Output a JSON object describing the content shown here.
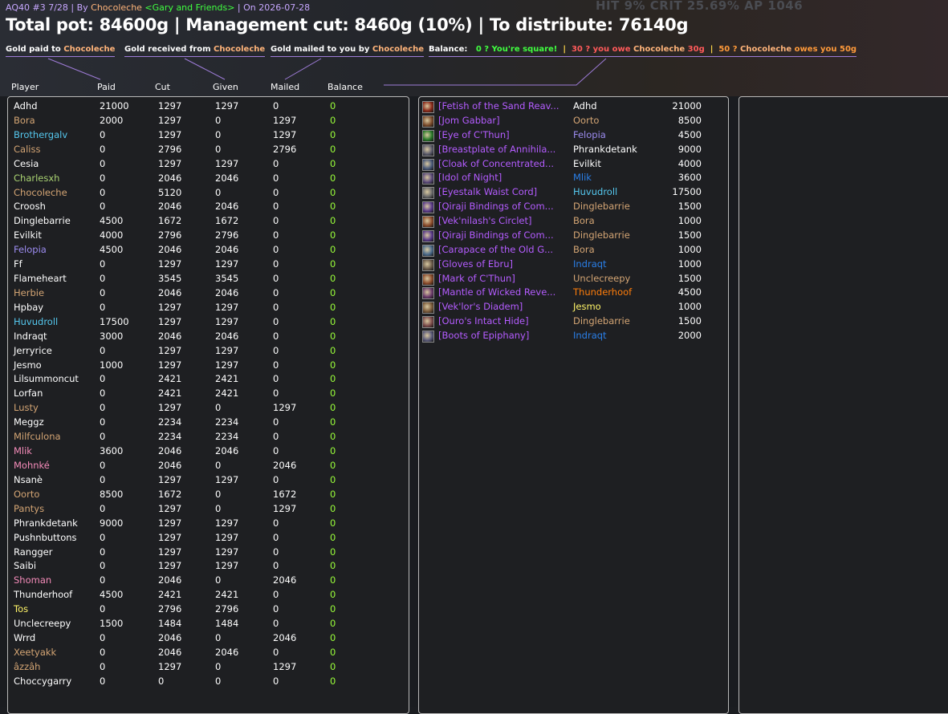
{
  "hud_text": "HIT 9%  CRIT 25.69%  AP 1046",
  "header": {
    "prefix": "AQ40 #3 7/28 | By ",
    "author": "Chocoleche",
    "guild": " <Gary and Friends>",
    "suffix": " | On 2026-07-28",
    "title": "Total pot: 84600g | Management cut: 8460g (10%) | To distribute: 76140g"
  },
  "legends": {
    "paid_text": "Gold paid to ",
    "paid_name": "Chocoleche",
    "received_text": "Gold received from ",
    "received_name": "Chocoleche",
    "mailed_text": "Gold mailed to you by ",
    "mailed_name": "Chocoleche",
    "balance_label": "Balance:",
    "balance_square": "0 ? You're square!",
    "sep1": "|",
    "balance_owe_prefix": "30 ? you owe ",
    "balance_owe_name": "Chocoleche",
    "balance_owe_amount": " 30g",
    "sep2": "|",
    "balance_owes_prefix": "50 ? ",
    "balance_owes_name": "Chocoleche",
    "balance_owes_suffix": " owes you 50g"
  },
  "columns": {
    "player": "Player",
    "paid": "Paid",
    "cut": "Cut",
    "given": "Given",
    "mailed": "Mailed",
    "balance": "Balance"
  },
  "colors": {
    "warrior": "#d4a574",
    "mage": "#55c8ef",
    "hunter": "#aad372",
    "paladin": "#f58cba",
    "warlock": "#9c8cf0",
    "shaman": "#2a7fe8",
    "rogue": "#fff468",
    "druid": "#ff7d0a",
    "priest": "#ffffff",
    "balance_zero": "#9aff3a",
    "epic": "#b45cff"
  },
  "players": [
    {
      "name": "Adhd",
      "cls": "priest",
      "paid": "21000",
      "cut": "1297",
      "given": "1297",
      "mailed": "0",
      "balance": "0"
    },
    {
      "name": "Bora",
      "cls": "warrior",
      "paid": "2000",
      "cut": "1297",
      "given": "0",
      "mailed": "1297",
      "balance": "0"
    },
    {
      "name": "Brothergalv",
      "cls": "mage",
      "paid": "0",
      "cut": "1297",
      "given": "0",
      "mailed": "1297",
      "balance": "0"
    },
    {
      "name": "Caliss",
      "cls": "warrior",
      "paid": "0",
      "cut": "2796",
      "given": "0",
      "mailed": "2796",
      "balance": "0"
    },
    {
      "name": "Cesia",
      "cls": "priest",
      "paid": "0",
      "cut": "1297",
      "given": "1297",
      "mailed": "0",
      "balance": "0"
    },
    {
      "name": "Charlesxh",
      "cls": "hunter",
      "paid": "0",
      "cut": "2046",
      "given": "2046",
      "mailed": "0",
      "balance": "0"
    },
    {
      "name": "Chocoleche",
      "cls": "warrior",
      "paid": "0",
      "cut": "5120",
      "given": "0",
      "mailed": "0",
      "balance": "0"
    },
    {
      "name": "Croosh",
      "cls": "priest",
      "paid": "0",
      "cut": "2046",
      "given": "2046",
      "mailed": "0",
      "balance": "0"
    },
    {
      "name": "Dinglebarrie",
      "cls": "priest",
      "paid": "4500",
      "cut": "1672",
      "given": "1672",
      "mailed": "0",
      "balance": "0"
    },
    {
      "name": "Evilkit",
      "cls": "priest",
      "paid": "4000",
      "cut": "2796",
      "given": "2796",
      "mailed": "0",
      "balance": "0"
    },
    {
      "name": "Felopia",
      "cls": "warlock",
      "paid": "4500",
      "cut": "2046",
      "given": "2046",
      "mailed": "0",
      "balance": "0"
    },
    {
      "name": "Ff",
      "cls": "priest",
      "paid": "0",
      "cut": "1297",
      "given": "1297",
      "mailed": "0",
      "balance": "0"
    },
    {
      "name": "Flameheart",
      "cls": "priest",
      "paid": "0",
      "cut": "3545",
      "given": "3545",
      "mailed": "0",
      "balance": "0"
    },
    {
      "name": "Herbie",
      "cls": "warrior",
      "paid": "0",
      "cut": "2046",
      "given": "2046",
      "mailed": "0",
      "balance": "0"
    },
    {
      "name": "Hpbay",
      "cls": "priest",
      "paid": "0",
      "cut": "1297",
      "given": "1297",
      "mailed": "0",
      "balance": "0"
    },
    {
      "name": "Huvudroll",
      "cls": "mage",
      "paid": "17500",
      "cut": "1297",
      "given": "1297",
      "mailed": "0",
      "balance": "0"
    },
    {
      "name": "Indraqt",
      "cls": "priest",
      "paid": "3000",
      "cut": "2046",
      "given": "2046",
      "mailed": "0",
      "balance": "0"
    },
    {
      "name": "Jerryrice",
      "cls": "priest",
      "paid": "0",
      "cut": "1297",
      "given": "1297",
      "mailed": "0",
      "balance": "0"
    },
    {
      "name": "Jesmo",
      "cls": "priest",
      "paid": "1000",
      "cut": "1297",
      "given": "1297",
      "mailed": "0",
      "balance": "0"
    },
    {
      "name": "Lilsummoncut",
      "cls": "priest",
      "paid": "0",
      "cut": "2421",
      "given": "2421",
      "mailed": "0",
      "balance": "0"
    },
    {
      "name": "Lorfan",
      "cls": "priest",
      "paid": "0",
      "cut": "2421",
      "given": "2421",
      "mailed": "0",
      "balance": "0"
    },
    {
      "name": "Lusty",
      "cls": "warrior",
      "paid": "0",
      "cut": "1297",
      "given": "0",
      "mailed": "1297",
      "balance": "0"
    },
    {
      "name": "Meggz",
      "cls": "priest",
      "paid": "0",
      "cut": "2234",
      "given": "2234",
      "mailed": "0",
      "balance": "0"
    },
    {
      "name": "Milfculona",
      "cls": "warrior",
      "paid": "0",
      "cut": "2234",
      "given": "2234",
      "mailed": "0",
      "balance": "0"
    },
    {
      "name": "Mlik",
      "cls": "paladin",
      "paid": "3600",
      "cut": "2046",
      "given": "2046",
      "mailed": "0",
      "balance": "0"
    },
    {
      "name": "Mohnké",
      "cls": "paladin",
      "paid": "0",
      "cut": "2046",
      "given": "0",
      "mailed": "2046",
      "balance": "0"
    },
    {
      "name": "Nsanè",
      "cls": "priest",
      "paid": "0",
      "cut": "1297",
      "given": "1297",
      "mailed": "0",
      "balance": "0"
    },
    {
      "name": "Oorto",
      "cls": "warrior",
      "paid": "8500",
      "cut": "1672",
      "given": "0",
      "mailed": "1672",
      "balance": "0"
    },
    {
      "name": "Pantys",
      "cls": "warrior",
      "paid": "0",
      "cut": "1297",
      "given": "0",
      "mailed": "1297",
      "balance": "0"
    },
    {
      "name": "Phrankdetank",
      "cls": "priest",
      "paid": "9000",
      "cut": "1297",
      "given": "1297",
      "mailed": "0",
      "balance": "0"
    },
    {
      "name": "Pushnbuttons",
      "cls": "priest",
      "paid": "0",
      "cut": "1297",
      "given": "1297",
      "mailed": "0",
      "balance": "0"
    },
    {
      "name": "Rangger",
      "cls": "priest",
      "paid": "0",
      "cut": "1297",
      "given": "1297",
      "mailed": "0",
      "balance": "0"
    },
    {
      "name": "Saibi",
      "cls": "priest",
      "paid": "0",
      "cut": "1297",
      "given": "1297",
      "mailed": "0",
      "balance": "0"
    },
    {
      "name": "Shoman",
      "cls": "paladin",
      "paid": "0",
      "cut": "2046",
      "given": "0",
      "mailed": "2046",
      "balance": "0"
    },
    {
      "name": "Thunderhoof",
      "cls": "priest",
      "paid": "4500",
      "cut": "2421",
      "given": "2421",
      "mailed": "0",
      "balance": "0"
    },
    {
      "name": "Tos",
      "cls": "rogue",
      "paid": "0",
      "cut": "2796",
      "given": "2796",
      "mailed": "0",
      "balance": "0"
    },
    {
      "name": "Unclecreepy",
      "cls": "priest",
      "paid": "1500",
      "cut": "1484",
      "given": "1484",
      "mailed": "0",
      "balance": "0"
    },
    {
      "name": "Wrrd",
      "cls": "priest",
      "paid": "0",
      "cut": "2046",
      "given": "0",
      "mailed": "2046",
      "balance": "0"
    },
    {
      "name": "Xeetyakk",
      "cls": "warrior",
      "paid": "0",
      "cut": "2046",
      "given": "2046",
      "mailed": "0",
      "balance": "0"
    },
    {
      "name": "âzzâh",
      "cls": "warrior",
      "paid": "0",
      "cut": "1297",
      "given": "0",
      "mailed": "1297",
      "balance": "0"
    },
    {
      "name": "Choccygarry",
      "cls": "priest",
      "paid": "0",
      "cut": "0",
      "given": "0",
      "mailed": "0",
      "balance": "0"
    }
  ],
  "loot": [
    {
      "icon": "skull-icon",
      "icon_color": "#8a2a1a",
      "item": "[Fetish of the Sand Reav...",
      "winner": "Adhd",
      "cls": "priest",
      "price": "21000"
    },
    {
      "icon": "head-icon",
      "icon_color": "#7a4a2a",
      "item": "[Jom Gabbar]",
      "winner": "Oorto",
      "cls": "warrior",
      "price": "8500"
    },
    {
      "icon": "eye-icon",
      "icon_color": "#2a7a2a",
      "item": "[Eye of C'Thun]",
      "winner": "Felopia",
      "cls": "warlock",
      "price": "4500"
    },
    {
      "icon": "armor-icon",
      "icon_color": "#5a5a6a",
      "item": "[Breastplate of Annihila...",
      "winner": "Phrankdetank",
      "cls": "priest",
      "price": "9000"
    },
    {
      "icon": "cloak-icon",
      "icon_color": "#4a5a7a",
      "item": "[Cloak of Concentrated...",
      "winner": "Evilkit",
      "cls": "priest",
      "price": "4000"
    },
    {
      "icon": "idol-icon",
      "icon_color": "#5a4a7a",
      "item": "[Idol of Night]",
      "winner": "Mlik",
      "cls": "shaman",
      "price": "3600"
    },
    {
      "icon": "belt-icon",
      "icon_color": "#6a6a6a",
      "item": "[Eyestalk Waist Cord]",
      "winner": "Huvudroll",
      "cls": "mage",
      "price": "17500"
    },
    {
      "icon": "bracer-icon",
      "icon_color": "#5a3a8a",
      "item": "[Qiraji Bindings of Com...",
      "winner": "Dinglebarrie",
      "cls": "warrior",
      "price": "1500"
    },
    {
      "icon": "ring-icon",
      "icon_color": "#8a4a2a",
      "item": "[Vek'nilash's Circlet]",
      "winner": "Bora",
      "cls": "warrior",
      "price": "1000"
    },
    {
      "icon": "bracer-icon",
      "icon_color": "#5a3a8a",
      "item": "[Qiraji Bindings of Com...",
      "winner": "Dinglebarrie",
      "cls": "warrior",
      "price": "1500"
    },
    {
      "icon": "shield-icon",
      "icon_color": "#4a6a8a",
      "item": "[Carapace of the Old G...",
      "winner": "Bora",
      "cls": "warrior",
      "price": "1000"
    },
    {
      "icon": "gloves-icon",
      "icon_color": "#6a5a4a",
      "item": "[Gloves of Ebru]",
      "winner": "Indraqt",
      "cls": "shaman",
      "price": "1000"
    },
    {
      "icon": "mark-icon",
      "icon_color": "#8a4a2a",
      "item": "[Mark of C'Thun]",
      "winner": "Unclecreepy",
      "cls": "warrior",
      "price": "1500"
    },
    {
      "icon": "shoulder-icon",
      "icon_color": "#6a3a6a",
      "item": "[Mantle of Wicked Reve...",
      "winner": "Thunderhoof",
      "cls": "druid",
      "price": "4500"
    },
    {
      "icon": "helm-icon",
      "icon_color": "#7a5a3a",
      "item": "[Vek'lor's Diadem]",
      "winner": "Jesmo",
      "cls": "rogue",
      "price": "1000"
    },
    {
      "icon": "hide-icon",
      "icon_color": "#7a4a4a",
      "item": "[Ouro's Intact Hide]",
      "winner": "Dinglebarrie",
      "cls": "warrior",
      "price": "1500"
    },
    {
      "icon": "boots-icon",
      "icon_color": "#5a5a7a",
      "item": "[Boots of Epiphany]",
      "winner": "Indraqt",
      "cls": "shaman",
      "price": "2000"
    }
  ]
}
